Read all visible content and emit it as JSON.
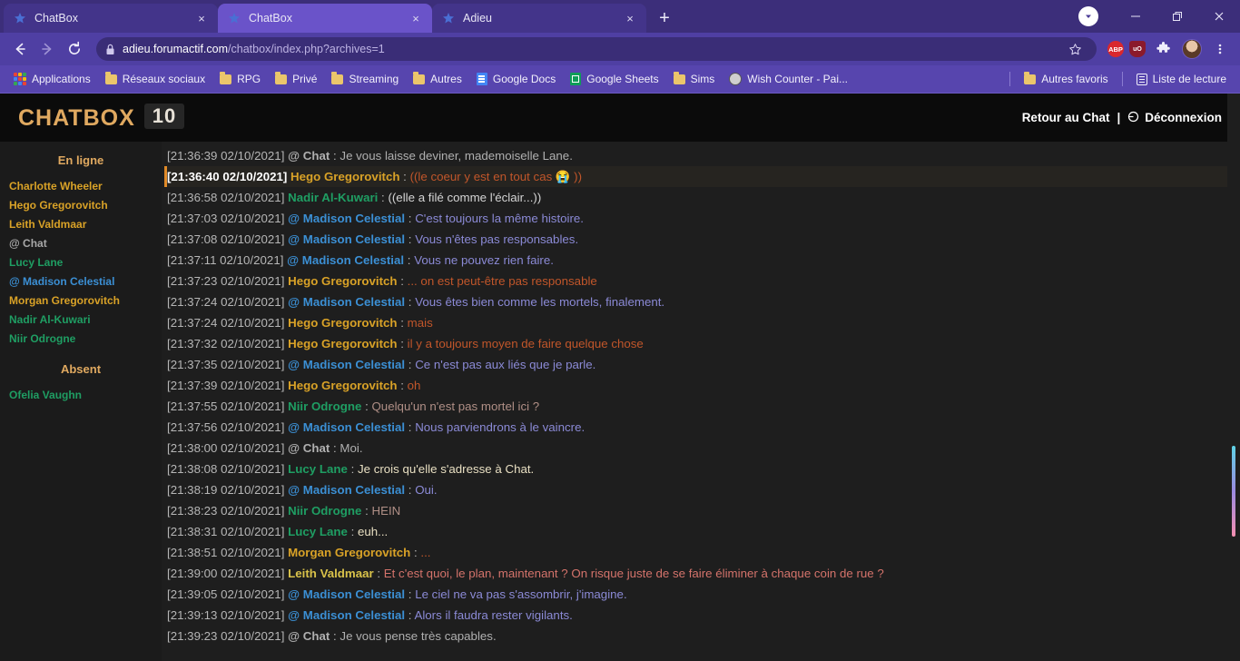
{
  "browser": {
    "tabs": [
      {
        "title": "ChatBox",
        "active": false,
        "favicon": "star-favicon",
        "close_label": "×"
      },
      {
        "title": "ChatBox",
        "active": true,
        "favicon": "star-favicon",
        "close_label": "×"
      },
      {
        "title": "Adieu",
        "active": false,
        "favicon": "star-favicon",
        "close_label": "×"
      }
    ],
    "new_tab_label": "+",
    "window_controls": {
      "minimize": "—",
      "maximize": "❐",
      "close": "✕"
    },
    "nav": {
      "back": "←",
      "forward": "→",
      "reload": "⟳"
    },
    "omnibox": {
      "lock_icon": "lock-icon",
      "host": "adieu.forumactif.com",
      "path": "/chatbox/index.php?archives=1",
      "full_url": "adieu.forumactif.com/chatbox/index.php?archives=1",
      "star_icon": "bookmark-star-icon"
    },
    "extensions": [
      {
        "name": "adblock-plus",
        "label": "ABP"
      },
      {
        "name": "ublock-origin",
        "label": "uO"
      },
      {
        "name": "extensions-puzzle",
        "label": ""
      }
    ],
    "menu_icon": "three-dots-vertical-icon",
    "bookmarks": [
      {
        "label": "Applications",
        "icon": "apps-grid-icon"
      },
      {
        "label": "Réseaux sociaux",
        "icon": "folder-icon"
      },
      {
        "label": "RPG",
        "icon": "folder-icon"
      },
      {
        "label": "Privé",
        "icon": "folder-icon"
      },
      {
        "label": "Streaming",
        "icon": "folder-icon"
      },
      {
        "label": "Autres",
        "icon": "folder-icon"
      },
      {
        "label": "Google Docs",
        "icon": "google-docs-icon"
      },
      {
        "label": "Google Sheets",
        "icon": "google-sheets-icon"
      },
      {
        "label": "Sims",
        "icon": "folder-icon"
      },
      {
        "label": "Wish Counter - Pai...",
        "icon": "wish-counter-icon"
      }
    ],
    "bookmarks_right": [
      {
        "label": "Autres favoris",
        "icon": "folder-icon"
      },
      {
        "label": "Liste de lecture",
        "icon": "reading-list-icon"
      }
    ]
  },
  "chat": {
    "title": "CHATBOX",
    "count": "10",
    "back_link": "Retour au Chat",
    "separator": "|",
    "logout_label": "Déconnexion",
    "logout_icon": "power-icon",
    "sidebar": {
      "online_heading": "En ligne",
      "online_users": [
        {
          "name": "Charlotte Wheeler",
          "color": "#d9a227"
        },
        {
          "name": "Hego Gregorovitch",
          "color": "#d9a227"
        },
        {
          "name": "Leith Valdmaar",
          "color": "#d9a227"
        },
        {
          "name": "@ Chat",
          "color": "#a8a8a8"
        },
        {
          "name": "Lucy Lane",
          "color": "#1f9e63"
        },
        {
          "name": "@ Madison Celestial",
          "color": "#3b8fd4"
        },
        {
          "name": "Morgan Gregorovitch",
          "color": "#d9a227"
        },
        {
          "name": "Nadir Al-Kuwari",
          "color": "#1f9e63"
        },
        {
          "name": "Niir Odrogne",
          "color": "#1f9e63"
        }
      ],
      "away_heading": "Absent",
      "away_users": [
        {
          "name": "Ofelia Vaughn",
          "color": "#1f9e63"
        }
      ]
    },
    "messages": [
      {
        "timestamp": "[21:36:39 02/10/2021]",
        "author": "@ Chat",
        "author_color": "#b0b0b0",
        "text": "Je vous laisse deviner, mademoiselle Lane.",
        "text_color": "#b0b0b0",
        "highlighted": false
      },
      {
        "timestamp": "[21:36:40 02/10/2021]",
        "author": "Hego Gregorovitch",
        "author_color": "#d9a227",
        "text": "((le coeur y est en tout cas 😭 ))",
        "text_color": "#c1562a",
        "highlighted": true
      },
      {
        "timestamp": "[21:36:58 02/10/2021]",
        "author": "Nadir Al-Kuwari",
        "author_color": "#1f9e63",
        "text": "((elle a filé comme l'éclair...))",
        "text_color": "#d5d5d5",
        "highlighted": false
      },
      {
        "timestamp": "[21:37:03 02/10/2021]",
        "author": "@ Madison Celestial",
        "author_color": "#3b8fd4",
        "text": "C'est toujours la même histoire.",
        "text_color": "#8b8ad6",
        "highlighted": false
      },
      {
        "timestamp": "[21:37:08 02/10/2021]",
        "author": "@ Madison Celestial",
        "author_color": "#3b8fd4",
        "text": "Vous n'êtes pas responsables.",
        "text_color": "#8b8ad6",
        "highlighted": false
      },
      {
        "timestamp": "[21:37:11 02/10/2021]",
        "author": "@ Madison Celestial",
        "author_color": "#3b8fd4",
        "text": "Vous ne pouvez rien faire.",
        "text_color": "#8b8ad6",
        "highlighted": false
      },
      {
        "timestamp": "[21:37:23 02/10/2021]",
        "author": "Hego Gregorovitch",
        "author_color": "#d9a227",
        "text": "... on est peut-être pas responsable",
        "text_color": "#c1562a",
        "highlighted": false
      },
      {
        "timestamp": "[21:37:24 02/10/2021]",
        "author": "@ Madison Celestial",
        "author_color": "#3b8fd4",
        "text": "Vous êtes bien comme les mortels, finalement.",
        "text_color": "#8b8ad6",
        "highlighted": false
      },
      {
        "timestamp": "[21:37:24 02/10/2021]",
        "author": "Hego Gregorovitch",
        "author_color": "#d9a227",
        "text": "mais",
        "text_color": "#c1562a",
        "highlighted": false
      },
      {
        "timestamp": "[21:37:32 02/10/2021]",
        "author": "Hego Gregorovitch",
        "author_color": "#d9a227",
        "text": "il y a toujours moyen de faire quelque chose",
        "text_color": "#c1562a",
        "highlighted": false
      },
      {
        "timestamp": "[21:37:35 02/10/2021]",
        "author": "@ Madison Celestial",
        "author_color": "#3b8fd4",
        "text": "Ce n'est pas aux liés que je parle.",
        "text_color": "#8b8ad6",
        "highlighted": false
      },
      {
        "timestamp": "[21:37:39 02/10/2021]",
        "author": "Hego Gregorovitch",
        "author_color": "#d9a227",
        "text": "oh",
        "text_color": "#c1562a",
        "highlighted": false
      },
      {
        "timestamp": "[21:37:55 02/10/2021]",
        "author": "Niir Odrogne",
        "author_color": "#1f9e63",
        "text": "Quelqu'un n'est pas mortel ici ?",
        "text_color": "#b08f86",
        "highlighted": false
      },
      {
        "timestamp": "[21:37:56 02/10/2021]",
        "author": "@ Madison Celestial",
        "author_color": "#3b8fd4",
        "text": "Nous parviendrons à le vaincre.",
        "text_color": "#8b8ad6",
        "highlighted": false
      },
      {
        "timestamp": "[21:38:00 02/10/2021]",
        "author": "@ Chat",
        "author_color": "#b0b0b0",
        "text": "Moi.",
        "text_color": "#b0b0b0",
        "highlighted": false
      },
      {
        "timestamp": "[21:38:08 02/10/2021]",
        "author": "Lucy Lane",
        "author_color": "#1f9e63",
        "text": "Je crois qu'elle s'adresse à Chat.",
        "text_color": "#e8dfc2",
        "highlighted": false
      },
      {
        "timestamp": "[21:38:19 02/10/2021]",
        "author": "@ Madison Celestial",
        "author_color": "#3b8fd4",
        "text": "Oui.",
        "text_color": "#8b8ad6",
        "highlighted": false
      },
      {
        "timestamp": "[21:38:23 02/10/2021]",
        "author": "Niir Odrogne",
        "author_color": "#1f9e63",
        "text": "HEIN",
        "text_color": "#b08f86",
        "highlighted": false
      },
      {
        "timestamp": "[21:38:31 02/10/2021]",
        "author": "Lucy Lane",
        "author_color": "#1f9e63",
        "text": "euh...",
        "text_color": "#e8dfc2",
        "highlighted": false
      },
      {
        "timestamp": "[21:38:51 02/10/2021]",
        "author": "Morgan Gregorovitch",
        "author_color": "#d9a227",
        "text": "...",
        "text_color": "#c1562a",
        "highlighted": false
      },
      {
        "timestamp": "[21:39:00 02/10/2021]",
        "author": "Leith Valdmaar",
        "author_color": "#d9c24a",
        "text": "Et c'est quoi, le plan, maintenant ? On risque juste de se faire éliminer à chaque coin de rue ?",
        "text_color": "#d4736b",
        "highlighted": false
      },
      {
        "timestamp": "[21:39:05 02/10/2021]",
        "author": "@ Madison Celestial",
        "author_color": "#3b8fd4",
        "text": "Le ciel ne va pas s'assombrir, j'imagine.",
        "text_color": "#8b8ad6",
        "highlighted": false
      },
      {
        "timestamp": "[21:39:13 02/10/2021]",
        "author": "@ Madison Celestial",
        "author_color": "#3b8fd4",
        "text": "Alors il faudra rester vigilants.",
        "text_color": "#8b8ad6",
        "highlighted": false
      },
      {
        "timestamp": "[21:39:23 02/10/2021]",
        "author": "@ Chat",
        "author_color": "#b0b0b0",
        "text": "Je vous pense très capables.",
        "text_color": "#b0b0b0",
        "highlighted": false
      }
    ],
    "colors": {
      "accent": "#e0a960",
      "background": "#1e1e1e",
      "header_background": "#0b0b0b",
      "sidebar_background": "#1b1b1b",
      "highlight_border": "#e08a28"
    }
  }
}
